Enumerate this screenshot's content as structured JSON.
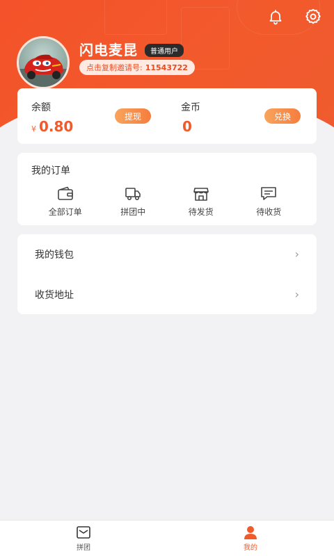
{
  "header": {
    "username": "闪电麦昆",
    "user_type_badge": "普通用户",
    "invite_prefix": "点击复制邀请号:",
    "invite_code": "11543722",
    "icons": [
      "bell-icon",
      "gear-icon"
    ]
  },
  "balance": {
    "label": "余额",
    "currency": "¥",
    "value": "0.80",
    "action_label": "提现"
  },
  "coins": {
    "label": "金币",
    "value": "0",
    "action_label": "兑换"
  },
  "orders": {
    "title": "我的订单",
    "items": [
      {
        "label": "全部订单",
        "icon": "wallet-icon"
      },
      {
        "label": "拼团中",
        "icon": "truck-icon"
      },
      {
        "label": "待发货",
        "icon": "store-icon"
      },
      {
        "label": "待收货",
        "icon": "message-icon"
      }
    ]
  },
  "menu": {
    "items": [
      {
        "label": "我的钱包"
      },
      {
        "label": "收货地址"
      }
    ]
  },
  "tabbar": {
    "tabs": [
      {
        "label": "拼团",
        "icon": "inbox-icon",
        "active": false
      },
      {
        "label": "我的",
        "icon": "person-icon",
        "active": true
      }
    ]
  },
  "colors": {
    "brand": "#f15a2a",
    "button_gradient_start": "#f8a45c",
    "button_gradient_end": "#f57d3e",
    "background": "#f2f2f4"
  }
}
